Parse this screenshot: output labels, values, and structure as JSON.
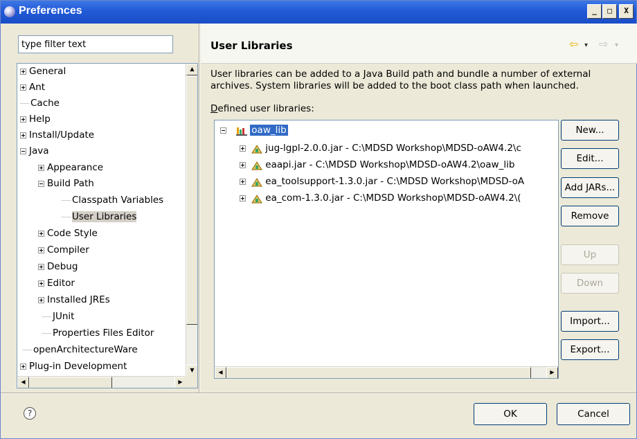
{
  "window": {
    "title": "Preferences",
    "controls": {
      "minimize": "_",
      "maximize": "□",
      "close": "X"
    }
  },
  "filter": {
    "placeholder": "type filter text",
    "value": "type filter text"
  },
  "tree": {
    "items": [
      {
        "label": "General",
        "state": "collapsed",
        "level": 0
      },
      {
        "label": "Ant",
        "state": "collapsed",
        "level": 0
      },
      {
        "label": "Cache",
        "state": "leaf",
        "level": 0
      },
      {
        "label": "Help",
        "state": "collapsed",
        "level": 0
      },
      {
        "label": "Install/Update",
        "state": "collapsed",
        "level": 0
      },
      {
        "label": "Java",
        "state": "expanded",
        "level": 0
      },
      {
        "label": "Appearance",
        "state": "collapsed",
        "level": 1
      },
      {
        "label": "Build Path",
        "state": "expanded",
        "level": 1
      },
      {
        "label": "Classpath Variables",
        "state": "leaf",
        "level": 2
      },
      {
        "label": "User Libraries",
        "state": "leaf",
        "level": 2,
        "selected": true
      },
      {
        "label": "Code Style",
        "state": "collapsed",
        "level": 1
      },
      {
        "label": "Compiler",
        "state": "collapsed",
        "level": 1
      },
      {
        "label": "Debug",
        "state": "collapsed",
        "level": 1
      },
      {
        "label": "Editor",
        "state": "collapsed",
        "level": 1
      },
      {
        "label": "Installed JREs",
        "state": "collapsed",
        "level": 1
      },
      {
        "label": "JUnit",
        "state": "leaf",
        "level": 1
      },
      {
        "label": "Properties Files Editor",
        "state": "leaf",
        "level": 1
      },
      {
        "label": "openArchitectureWare",
        "state": "leaf",
        "level": 0
      },
      {
        "label": "Plug-in Development",
        "state": "collapsed",
        "level": 0
      }
    ]
  },
  "page": {
    "title": "User Libraries",
    "description": "User libraries can be added to a Java Build path and bundle a number of external archives. System libraries will be added to the boot class path when launched.",
    "defined_label_mnemonic": "D",
    "defined_label_rest": "efined user libraries:"
  },
  "libraries": {
    "root": "oaw_lib",
    "jars": [
      "jug-lgpl-2.0.0.jar - C:\\MDSD Workshop\\MDSD-oAW4.2\\c",
      "eaapi.jar - C:\\MDSD Workshop\\MDSD-oAW4.2\\oaw_lib",
      "ea_toolsupport-1.3.0.jar - C:\\MDSD Workshop\\MDSD-oA",
      "ea_com-1.3.0.jar - C:\\MDSD Workshop\\MDSD-oAW4.2\\("
    ]
  },
  "buttons": {
    "new": "New...",
    "edit": "Edit...",
    "add_jars": "Add JARs...",
    "remove": "Remove",
    "up": "Up",
    "down": "Down",
    "import": "Import...",
    "export": "Export..."
  },
  "footer": {
    "ok": "OK",
    "cancel": "Cancel",
    "help": "?"
  },
  "nav": {
    "back": "⇦",
    "forward": "⇨",
    "dropdown": "▾"
  }
}
